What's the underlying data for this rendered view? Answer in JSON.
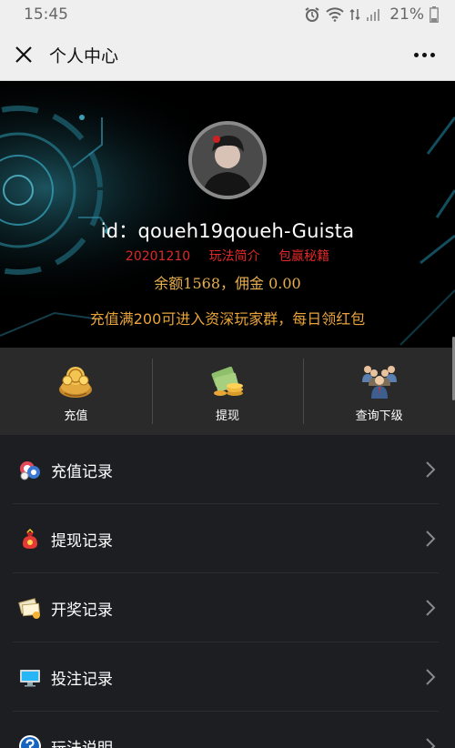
{
  "status_bar": {
    "time": "15:45",
    "battery": "21%"
  },
  "title_bar": {
    "title": "个人中心"
  },
  "profile": {
    "user_id": "id：qoueh19qoueh-Guista",
    "links": [
      "20201210",
      "玩法简介",
      "包赢秘籍"
    ],
    "balance": "余额1568，佣金 0.00",
    "notice": "充值满200可进入资深玩家群，每日领红包"
  },
  "actions": [
    {
      "label": "充值",
      "icon": "money-bag-icon"
    },
    {
      "label": "提现",
      "icon": "cash-coins-icon"
    },
    {
      "label": "查询下级",
      "icon": "team-people-icon"
    }
  ],
  "menu": [
    {
      "label": "充值记录",
      "icon": "poker-chips-icon"
    },
    {
      "label": "提现记录",
      "icon": "red-money-bag-icon"
    },
    {
      "label": "开奖记录",
      "icon": "lottery-tickets-icon"
    },
    {
      "label": "投注记录",
      "icon": "monitor-icon"
    },
    {
      "label": "玩法说明",
      "icon": "help-circle-icon"
    }
  ],
  "colors": {
    "background": "#1d1e21",
    "action_bar": "#2a2a2b",
    "link_red": "#e02828",
    "gold": "#e8b04e"
  }
}
